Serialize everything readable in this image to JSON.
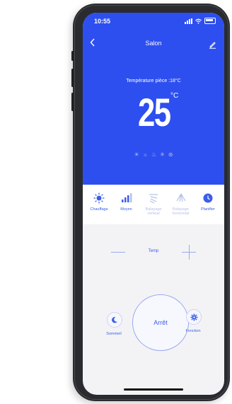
{
  "status_bar": {
    "time": "10:55"
  },
  "header": {
    "title": "Salon",
    "back_icon": "chevron-left-icon",
    "edit_icon": "pencil-icon"
  },
  "temperature": {
    "room_label": "Température pièce :18°C",
    "value": "25",
    "unit": "°C"
  },
  "mode_indicators": [
    "☀",
    "☼",
    "♨",
    "✳",
    "⊛"
  ],
  "tabs": [
    {
      "label": "Chauffage",
      "icon": "sun-icon",
      "active": true
    },
    {
      "label": "Moyen",
      "icon": "fan-speed-icon",
      "active": true
    },
    {
      "label": "Balayage vertical",
      "icon": "vertical-swing-icon",
      "active": false
    },
    {
      "label": "Balayage horizontal",
      "icon": "horizontal-swing-icon",
      "active": false
    },
    {
      "label": "Planifier",
      "icon": "clock-icon",
      "active": true
    }
  ],
  "temp_control": {
    "label": "Temp"
  },
  "buttons": {
    "sleep": "Sommeil",
    "power": "Arrêt",
    "function": "Fonction"
  },
  "colors": {
    "primary": "#2d4ff0",
    "accent": "#3b5ee8"
  }
}
